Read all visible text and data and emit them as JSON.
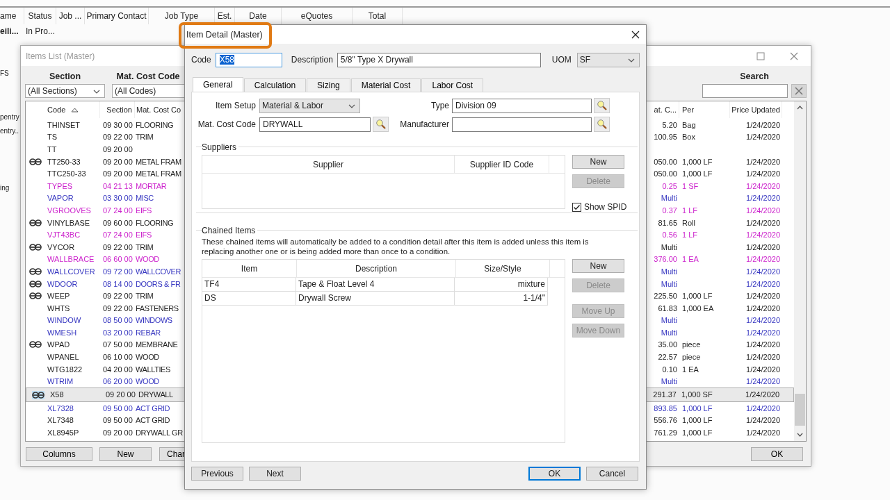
{
  "background_app": {
    "columns": [
      "ame",
      "Status",
      "Job ...",
      "Primary Contact",
      "Job Type",
      "Est.",
      "Date",
      "eQuotes",
      "Total"
    ],
    "row": {
      "name": "eili...",
      "status": "In Pro..."
    },
    "side_labels": [
      "FS",
      "pentry",
      "entry..",
      "ing"
    ]
  },
  "items_window": {
    "title": "Items List (Master)",
    "active": false,
    "filters": {
      "section_label": "Section",
      "section_value": "(All Sections)",
      "code_label": "Mat. Cost Code",
      "code_value": "(All Codes)",
      "search_label": "Search"
    },
    "columns_left": [
      {
        "label": "Code",
        "sorted": true
      },
      {
        "label": "Section",
        "sorted": false
      },
      {
        "label": "Mat. Cost Co",
        "sorted": false
      }
    ],
    "columns_right": [
      "at. C...",
      "Per",
      "Price Updated"
    ],
    "rows": [
      {
        "chained": false,
        "code": "THINSET",
        "section": "09 30 00",
        "cost_code": "FLOORING",
        "cost": "5.20",
        "per": "Bag",
        "updated": "1/24/2020",
        "color": "#222222",
        "selected": false
      },
      {
        "chained": false,
        "code": "TS",
        "section": "09 22 00",
        "cost_code": "TRIM",
        "cost": "100.95",
        "per": "Box",
        "updated": "1/24/2020",
        "color": "#222222",
        "selected": false
      },
      {
        "chained": false,
        "code": "TT",
        "section": "09 20 00",
        "color": "#222222",
        "selected": false
      },
      {
        "chained": true,
        "code": "TT250-33",
        "section": "09 20 00",
        "cost_code": "METAL FRAM",
        "cost": "050.00",
        "per": "1,000 LF",
        "updated": "1/24/2020",
        "color": "#222222",
        "selected": false
      },
      {
        "chained": false,
        "code": "TTC250-33",
        "section": "09 20 00",
        "cost_code": "METAL FRAM",
        "cost": "050.00",
        "per": "1,000 LF",
        "updated": "1/24/2020",
        "color": "#222222",
        "selected": false
      },
      {
        "chained": false,
        "code": "TYPES",
        "section": "04 21 13",
        "cost_code": "MORTAR",
        "cost": "0.25",
        "per": "1 SF",
        "updated": "1/24/2020",
        "color": "#cc22cc",
        "selected": false
      },
      {
        "chained": false,
        "code": "VAPOR",
        "section": "03 30 00",
        "cost_code": "MISC",
        "cost": "Multi",
        "updated": "1/24/2020",
        "color": "#3535c0",
        "selected": false
      },
      {
        "chained": false,
        "code": "VGROOVES",
        "section": "07 24 00",
        "cost_code": "EIFS",
        "cost": "0.37",
        "per": "1 LF",
        "updated": "1/24/2020",
        "color": "#cc22cc",
        "selected": false
      },
      {
        "chained": true,
        "code": "VINYLBASE",
        "section": "09 60 00",
        "cost_code": "FLOORING",
        "cost": "81.65",
        "per": "Roll",
        "updated": "1/24/2020",
        "color": "#222222",
        "selected": false
      },
      {
        "chained": false,
        "code": "VJT43BC",
        "section": "07 24 00",
        "cost_code": "EIFS",
        "cost": "0.56",
        "per": "1 LF",
        "updated": "1/24/2020",
        "color": "#cc22cc",
        "selected": false
      },
      {
        "chained": true,
        "code": "VYCOR",
        "section": "09 22 00",
        "cost_code": "TRIM",
        "cost": "Multi",
        "updated": "1/24/2020",
        "color": "#222222",
        "selected": false
      },
      {
        "chained": false,
        "code": "WALLBRACE",
        "section": "06 60 00",
        "cost_code": "WOOD",
        "cost": "376.00",
        "per": "1 EA",
        "updated": "1/24/2020",
        "color": "#cc22cc",
        "selected": false
      },
      {
        "chained": true,
        "code": "WALLCOVER",
        "section": "09 72 00",
        "cost_code": "WALLCOVER",
        "cost": "Multi",
        "updated": "1/24/2020",
        "color": "#3535c0",
        "selected": false
      },
      {
        "chained": true,
        "code": "WDOOR",
        "section": "08 14 00",
        "cost_code": "DOORS & FR",
        "cost": "Multi",
        "updated": "1/24/2020",
        "color": "#3535c0",
        "selected": false
      },
      {
        "chained": true,
        "code": "WEEP",
        "section": "09 22 00",
        "cost_code": "TRIM",
        "cost": "225.50",
        "per": "1,000 LF",
        "updated": "1/24/2020",
        "color": "#222222",
        "selected": false
      },
      {
        "chained": false,
        "code": "WHTS",
        "section": "09 22 00",
        "cost_code": "FASTENERS",
        "cost": "61.83",
        "per": "1,000 EA",
        "updated": "1/24/2020",
        "color": "#222222",
        "selected": false
      },
      {
        "chained": false,
        "code": "WINDOW",
        "section": "08 50 00",
        "cost_code": "WINDOWS",
        "cost": "Multi",
        "updated": "1/24/2020",
        "color": "#3535c0",
        "selected": false
      },
      {
        "chained": false,
        "code": "WMESH",
        "section": "03 20 00",
        "cost_code": "REBAR",
        "cost": "Multi",
        "updated": "1/24/2020",
        "color": "#3535c0",
        "selected": false
      },
      {
        "chained": true,
        "code": "WPAD",
        "section": "07 50 00",
        "cost_code": "MEMBRANE",
        "cost": "35.00",
        "per": "piece",
        "updated": "1/24/2020",
        "color": "#222222",
        "selected": false
      },
      {
        "chained": false,
        "code": "WPANEL",
        "section": "06 10 00",
        "cost_code": "WOOD",
        "cost": "22.57",
        "per": "piece",
        "updated": "1/24/2020",
        "color": "#222222",
        "selected": false
      },
      {
        "chained": false,
        "code": "WTG1822",
        "section": "04 20 00",
        "cost_code": "WALLTIES",
        "cost": "0.10",
        "per": "1 EA",
        "updated": "1/24/2020",
        "color": "#222222",
        "selected": false
      },
      {
        "chained": false,
        "code": "WTRIM",
        "section": "06 20 00",
        "cost_code": "WOOD",
        "cost": "Multi",
        "updated": "1/24/2020",
        "color": "#3535c0",
        "selected": false
      },
      {
        "chained": true,
        "code": "X58",
        "section": "09 20 00",
        "cost_code": "DRYWALL",
        "cost": "291.37",
        "per": "1,000 SF",
        "updated": "1/24/2020",
        "color": "#222222",
        "selected": true
      },
      {
        "chained": false,
        "code": "XL7328",
        "section": "09 50 00",
        "cost_code": "ACT GRID",
        "cost": "893.85",
        "per": "1,000 LF",
        "updated": "1/24/2020",
        "color": "#3535c0",
        "selected": false
      },
      {
        "chained": false,
        "code": "XL7348",
        "section": "09 50 00",
        "cost_code": "ACT GRID",
        "cost": "556.76",
        "per": "1,000 LF",
        "updated": "1/24/2020",
        "color": "#222222",
        "selected": false
      },
      {
        "chained": false,
        "code": "XL8945P",
        "section": "09 20 00",
        "cost_code": "DRYWALL GR",
        "cost": "761.29",
        "per": "1,000 LF",
        "updated": "1/24/2020",
        "color": "#222222",
        "selected": false
      }
    ],
    "buttons": [
      "Columns",
      "New",
      "Char"
    ],
    "ok_button": "OK"
  },
  "dialog": {
    "title": "Item Detail (Master)",
    "code_label": "Code",
    "code_value": "X58",
    "code_selected": true,
    "description_label": "Description",
    "description_value": "5/8\" Type X Drywall",
    "uom_label": "UOM",
    "uom_value": "SF",
    "tabs": [
      {
        "label": "General",
        "selected": true
      },
      {
        "label": "Calculation",
        "selected": false
      },
      {
        "label": "Sizing",
        "selected": false
      },
      {
        "label": "Material Cost",
        "selected": false
      },
      {
        "label": "Labor Cost",
        "selected": false
      }
    ],
    "general": {
      "item_setup_label": "Item Setup",
      "item_setup_value": "Material & Labor",
      "type_label": "Type",
      "type_value": "Division 09",
      "cost_code_label": "Mat. Cost Code",
      "cost_code_value": "DRYWALL",
      "manufacturer_label": "Manufacturer"
    },
    "suppliers": {
      "title": "Suppliers",
      "columns": [
        "Supplier",
        "Supplier ID Code"
      ],
      "buttons": [
        {
          "label": "New",
          "disabled": false
        },
        {
          "label": "Delete",
          "disabled": true
        }
      ],
      "show_spid": {
        "label": "Show SPID",
        "checked": true
      }
    },
    "chained": {
      "title": "Chained Items",
      "note": "These chained items will automatically be added to a condition detail after this item is added unless this item is replacing another one or is being added more than once to a condition.",
      "columns": [
        "Item",
        "Description",
        "Size/Style"
      ],
      "rows": [
        {
          "item": "TF4",
          "description": "Tape & Float Level 4",
          "size": "mixture"
        },
        {
          "item": "DS",
          "description": "Drywall Screw",
          "size": "1-1/4\""
        }
      ],
      "buttons": [
        {
          "label": "New",
          "disabled": false
        },
        {
          "label": "Delete",
          "disabled": true
        },
        {
          "label": "Move Up",
          "disabled": true
        },
        {
          "label": "Move Down",
          "disabled": true
        }
      ]
    },
    "footer": {
      "left": [
        "Previous",
        "Next"
      ],
      "right": [
        {
          "label": "OK",
          "default": true
        },
        {
          "label": "Cancel",
          "default": false
        }
      ]
    }
  }
}
